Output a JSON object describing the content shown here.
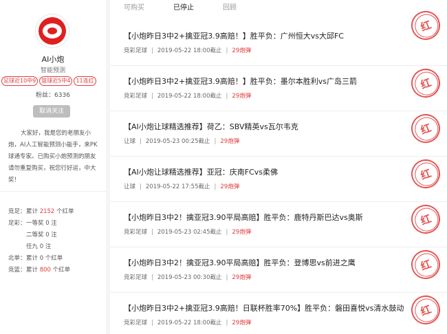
{
  "sidebar": {
    "name": "AI小炮",
    "subtitle": "智能预测",
    "tags": [
      "足球近10中9",
      "篮球近5中4",
      "11连红"
    ],
    "fans_label": "粉丝：",
    "fans_count": "6336",
    "unfollow": "取消关注",
    "bio": "大家好，我是您的老朋友小炮，AI人工智能预测小能手，来PK球通专家。已购买小炮预测的朋友请勿重复购买，祝您行好运，中大奖！",
    "stats": [
      {
        "key": "竞足：",
        "pre": "累计 ",
        "num": "2152",
        "post": " 个红单"
      },
      {
        "key": "足彩：",
        "pre": "一等奖 0 注",
        "num": "",
        "post": ""
      },
      {
        "key": "",
        "pre": "二等奖 0 注",
        "num": "",
        "post": ""
      },
      {
        "key": "",
        "pre": "任九 0 注",
        "num": "",
        "post": ""
      },
      {
        "key": "北单：",
        "pre": "累计 0 个红单",
        "num": "",
        "post": ""
      },
      {
        "key": "竞篮：",
        "pre": "累计 ",
        "num": "800",
        "post": " 个红单"
      }
    ]
  },
  "tabs": [
    "可购买",
    "已停止",
    "回顾"
  ],
  "active_tab": "已停止",
  "stamp_text": "红",
  "items": [
    {
      "title": "【小炮昨日3中2+擒亚冠3.9高赔！】胜平负：广州恒大vs大邱FC",
      "category": "竞彩足球",
      "time": "2019-05-22 18:00截止",
      "price": "29炮弹"
    },
    {
      "title": "【小炮昨日3中2+擒亚冠3.9高赔！】胜平负：墨尔本胜利vs广岛三箭",
      "category": "竞彩足球",
      "time": "2019-05-22 18:00截止",
      "price": "29炮弹"
    },
    {
      "title": "【AI小炮让球精选推荐】荷乙：SBV精英vs瓦尔韦克",
      "category": "让球",
      "time": "2019-05-23 00:25截止",
      "price": "29炮弹"
    },
    {
      "title": "【AI小炮让球精选推荐】亚冠：庆南FCvs柔佛",
      "category": "让球",
      "time": "2019-05-22 17:55截止",
      "price": "29炮弹"
    },
    {
      "title": "【小炮昨日3中2！擒亚冠3.90平局高赔】胜平负：鹿特丹斯巴达vs奥斯",
      "category": "竞彩足球",
      "time": "2019-05-23 02:45截止",
      "price": "29炮弹"
    },
    {
      "title": "【小炮昨日3中2！擒亚冠3.90平局高赔】胜平负：登博思vs前进之鹰",
      "category": "竞彩足球",
      "time": "2019-05-23 00:30截止",
      "price": "29炮弹"
    },
    {
      "title": "【小炮昨日3中2+擒亚冠3.9高赔！日联杯胜率70%】胜平负：磐田喜悦vs清水鼓动",
      "category": "竞彩足球",
      "time": "2019-05-22 18:00截止",
      "price": "29炮弹"
    }
  ]
}
